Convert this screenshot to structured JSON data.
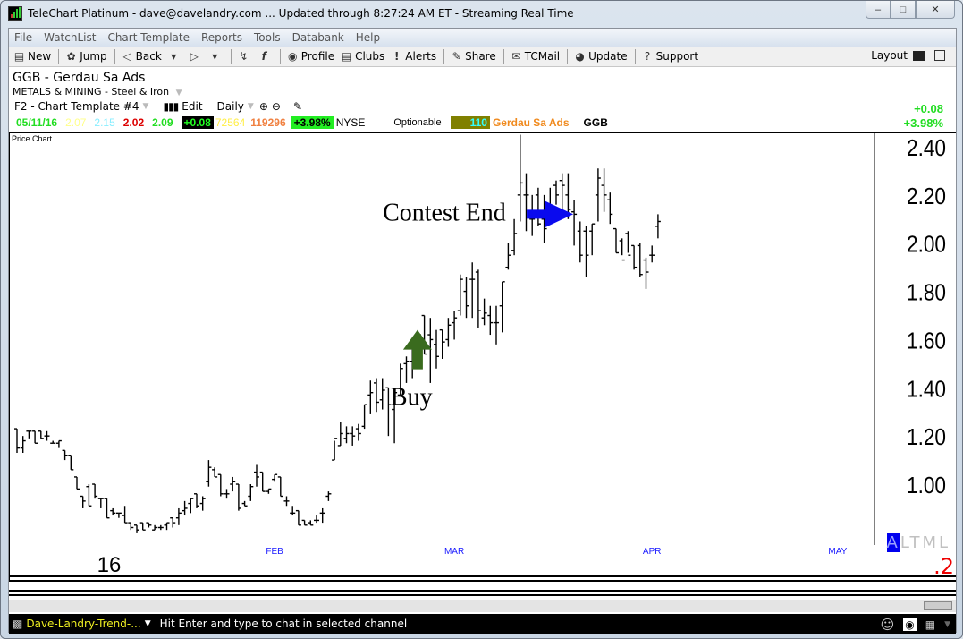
{
  "window": {
    "title": "TeleChart Platinum - dave@davelandry.com  ... Updated through 8:27:24 AM ET  -  Streaming Real Time",
    "controls": {
      "minimize": "–",
      "maximize": "□",
      "close": "✕"
    }
  },
  "menu": [
    "File",
    "WatchList",
    "Chart Template",
    "Reports",
    "Tools",
    "Databank",
    "Help"
  ],
  "toolbar": {
    "new": "New",
    "jump": "Jump",
    "back": "Back",
    "profile": "Profile",
    "clubs": "Clubs",
    "alerts": "Alerts",
    "share": "Share",
    "tcmail": "TCMail",
    "update": "Update",
    "support": "Support",
    "layout": "Layout"
  },
  "symbol": {
    "title": "GGB  -  Gerdau Sa Ads",
    "sector": "METALS & MINING - Steel & Iron",
    "template": "F2 - Chart Template #4",
    "edit": "Edit",
    "period": "Daily"
  },
  "quote": {
    "date": "05/11/16",
    "open": "2.07",
    "high": "2.15",
    "low": "2.02",
    "close": "2.09",
    "change": "+0.08",
    "volume": "72564",
    "avg_volume": "119296",
    "pct_change": "+3.98%",
    "exchange": "NYSE",
    "optionable": "Optionable",
    "rank": "110",
    "company": "Gerdau Sa Ads",
    "ticker": "GGB",
    "right_change": "+0.08",
    "right_pct": "+3.98%"
  },
  "colors": {
    "up": "#22dd22",
    "open": "#ffff88",
    "high": "#88eeff",
    "low": "#dd0000",
    "volume": "#ffee44",
    "avg_volume": "#f08040",
    "rank_bg": "#808000",
    "rank_fg": "#33ffff",
    "company": "#f08a1e",
    "month_label": "#1a1aff",
    "buy_arrow": "#3a6b1e",
    "contest_arrow": "#0a0aee"
  },
  "chart_data": {
    "type": "ohlc",
    "title": "Price Chart",
    "ylim": [
      0.78,
      2.48
    ],
    "yticks": [
      "2.40",
      "2.20",
      "2.00",
      "1.80",
      "1.60",
      "1.40",
      "1.20",
      "1.00"
    ],
    "ytick_values": [
      2.4,
      2.2,
      2.0,
      1.8,
      1.6,
      1.4,
      1.2,
      1.0
    ],
    "xtick_labels": [
      {
        "label": "16",
        "index": 15
      },
      {
        "label": "FEB",
        "index": 43
      },
      {
        "label": "MAR",
        "index": 73
      },
      {
        "label": "APR",
        "index": 106
      },
      {
        "label": "MAY",
        "index": 137
      }
    ],
    "bars": [
      [
        1.23,
        1.23,
        1.13,
        1.15
      ],
      [
        1.15,
        1.2,
        1.13,
        1.18
      ],
      [
        1.22,
        1.22,
        1.19,
        1.22
      ],
      [
        1.22,
        1.22,
        1.17,
        1.17
      ],
      [
        1.22,
        1.22,
        1.19,
        1.19
      ],
      [
        1.2,
        1.22,
        1.18,
        1.2
      ],
      [
        1.17,
        1.18,
        1.17,
        1.17
      ],
      [
        1.17,
        1.18,
        1.15,
        1.18
      ],
      [
        1.14,
        1.14,
        1.1,
        1.12
      ],
      [
        1.12,
        1.12,
        1.06,
        1.06
      ],
      [
        1.03,
        1.03,
        0.98,
        0.98
      ],
      [
        0.95,
        0.95,
        0.9,
        0.93
      ],
      [
        0.99,
        1.0,
        0.91,
        0.91
      ],
      [
        1.0,
        1.0,
        0.94,
        0.95
      ],
      [
        0.94,
        0.94,
        0.9,
        0.94
      ],
      [
        0.94,
        0.94,
        0.86,
        0.86
      ],
      [
        0.89,
        0.9,
        0.87,
        0.88
      ],
      [
        0.88,
        0.88,
        0.86,
        0.88
      ],
      [
        0.87,
        0.91,
        0.84,
        0.84
      ],
      [
        0.84,
        0.84,
        0.81,
        0.82
      ],
      [
        0.83,
        0.83,
        0.8,
        0.81
      ],
      [
        0.84,
        0.84,
        0.81,
        0.81
      ],
      [
        0.84,
        0.84,
        0.82,
        0.83
      ],
      [
        0.81,
        0.83,
        0.81,
        0.82
      ],
      [
        0.82,
        0.83,
        0.81,
        0.82
      ],
      [
        0.83,
        0.84,
        0.81,
        0.84
      ],
      [
        0.86,
        0.86,
        0.82,
        0.84
      ],
      [
        0.86,
        0.9,
        0.83,
        0.88
      ],
      [
        0.89,
        0.93,
        0.87,
        0.9
      ],
      [
        0.92,
        0.94,
        0.88,
        0.94
      ],
      [
        0.96,
        0.96,
        0.9,
        0.91
      ],
      [
        0.92,
        0.95,
        0.89,
        0.94
      ],
      [
        1.01,
        1.1,
        0.99,
        1.07
      ],
      [
        1.06,
        1.07,
        1.03,
        1.03
      ],
      [
        1.04,
        1.04,
        0.95,
        0.96
      ],
      [
        0.96,
        0.98,
        0.94,
        0.96
      ],
      [
        1.0,
        1.03,
        0.97,
        1.01
      ],
      [
        1.0,
        1.0,
        0.89,
        0.9
      ],
      [
        0.92,
        0.93,
        0.91,
        0.91
      ],
      [
        0.95,
        1.0,
        0.93,
        0.99
      ],
      [
        1.05,
        1.08,
        0.99,
        1.03
      ],
      [
        1.05,
        1.05,
        0.97,
        0.97
      ],
      [
        0.97,
        0.98,
        0.96,
        0.98
      ],
      [
        1.02,
        1.04,
        1.01,
        1.04
      ],
      [
        1.03,
        1.03,
        0.95,
        0.95
      ],
      [
        0.93,
        0.95,
        0.91,
        0.93
      ],
      [
        0.88,
        0.91,
        0.87,
        0.88
      ],
      [
        0.89,
        0.89,
        0.83,
        0.83
      ],
      [
        0.85,
        0.85,
        0.83,
        0.83
      ],
      [
        0.84,
        0.85,
        0.83,
        0.83
      ],
      [
        0.85,
        0.87,
        0.84,
        0.85
      ],
      [
        0.88,
        0.9,
        0.84,
        0.88
      ],
      [
        0.95,
        0.97,
        0.93,
        0.96
      ],
      [
        1.1,
        1.18,
        1.1,
        1.19
      ],
      [
        1.16,
        1.26,
        1.16,
        1.21
      ],
      [
        1.19,
        1.24,
        1.17,
        1.21
      ],
      [
        1.21,
        1.24,
        1.16,
        1.2
      ],
      [
        1.23,
        1.25,
        1.18,
        1.21
      ],
      [
        1.24,
        1.33,
        1.23,
        1.33
      ],
      [
        1.37,
        1.43,
        1.29,
        1.38
      ],
      [
        1.42,
        1.44,
        1.3,
        1.34
      ],
      [
        1.35,
        1.44,
        1.31,
        1.39
      ],
      [
        1.4,
        1.4,
        1.2,
        1.33
      ],
      [
        1.31,
        1.38,
        1.17,
        1.38
      ],
      [
        1.37,
        1.5,
        1.37,
        1.48
      ],
      [
        1.5,
        1.53,
        1.42,
        1.51
      ],
      [
        1.51,
        1.58,
        1.44,
        1.58
      ],
      [
        1.54,
        1.63,
        1.53,
        1.62
      ],
      [
        1.7,
        1.7,
        1.54,
        1.54
      ],
      [
        1.62,
        1.69,
        1.42,
        1.6
      ],
      [
        1.58,
        1.64,
        1.48,
        1.53
      ],
      [
        1.64,
        1.64,
        1.52,
        1.59
      ],
      [
        1.6,
        1.69,
        1.57,
        1.66
      ],
      [
        1.67,
        1.72,
        1.6,
        1.69
      ],
      [
        1.72,
        1.87,
        1.7,
        1.85
      ],
      [
        1.8,
        1.86,
        1.69,
        1.74
      ],
      [
        1.85,
        1.92,
        1.69,
        1.85
      ],
      [
        1.88,
        1.89,
        1.65,
        1.72
      ],
      [
        1.69,
        1.77,
        1.66,
        1.71
      ],
      [
        1.7,
        1.74,
        1.62,
        1.67
      ],
      [
        1.67,
        1.74,
        1.58,
        1.67
      ],
      [
        1.74,
        1.84,
        1.63,
        1.84
      ],
      [
        1.9,
        2.0,
        1.89,
        1.95
      ],
      [
        1.97,
        2.1,
        1.95,
        2.04
      ],
      [
        2.2,
        2.45,
        2.09,
        2.25
      ],
      [
        2.2,
        2.29,
        2.05,
        2.2
      ],
      [
        2.1,
        2.2,
        2.03,
        2.1
      ],
      [
        2.2,
        2.23,
        2.07,
        2.08
      ],
      [
        2.1,
        2.2,
        2.0,
        2.06
      ],
      [
        2.16,
        2.23,
        2.1,
        2.12
      ],
      [
        2.24,
        2.26,
        2.16,
        2.2
      ],
      [
        2.26,
        2.29,
        2.14,
        2.24
      ],
      [
        2.2,
        2.29,
        2.1,
        2.14
      ],
      [
        2.13,
        2.18,
        1.99,
        2.12
      ],
      [
        2.05,
        2.09,
        1.92,
        1.95
      ],
      [
        2.05,
        2.07,
        1.86,
        1.95
      ],
      [
        2.05,
        2.08,
        1.95,
        2.08
      ],
      [
        2.2,
        2.31,
        2.09,
        2.27
      ],
      [
        2.24,
        2.31,
        2.13,
        2.2
      ],
      [
        2.18,
        2.21,
        2.08,
        2.12
      ],
      [
        2.06,
        2.06,
        1.96,
        1.96
      ],
      [
        2.01,
        2.02,
        1.95,
        1.93
      ],
      [
        2.04,
        2.05,
        1.96,
        1.95
      ],
      [
        1.99,
        1.99,
        1.89,
        1.9
      ],
      [
        1.99,
        2.0,
        1.86,
        1.87
      ],
      [
        1.93,
        1.94,
        1.81,
        1.88
      ],
      [
        1.95,
        1.99,
        1.92,
        1.95
      ],
      [
        2.07,
        2.12,
        2.02,
        2.09
      ]
    ],
    "annotations": [
      {
        "text": "Buy",
        "type": "arrow-up",
        "bar_index": 67,
        "price": 1.64
      },
      {
        "text": "Contest End",
        "type": "arrow-right",
        "bar_index": 93,
        "price": 2.12
      }
    ],
    "side_labels": {
      "altml": [
        "A",
        "L",
        "T",
        "M",
        "L"
      ],
      "altml_selected": "A",
      "lower_value": ".2"
    }
  },
  "status": {
    "channel": "Dave-Landry-Trend-...",
    "hint": "Hit Enter and type to chat in selected channel"
  }
}
